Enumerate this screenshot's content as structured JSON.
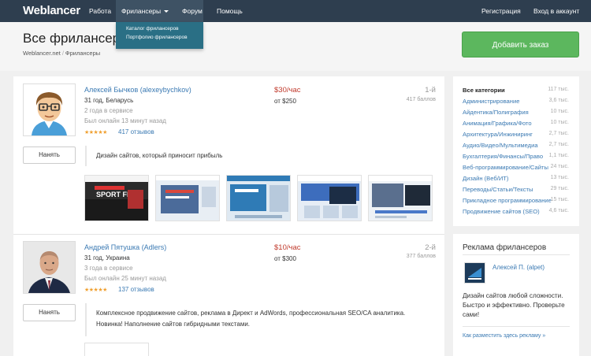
{
  "nav": {
    "logo": "Weblancer",
    "items": [
      {
        "label": "Работа"
      },
      {
        "label": "Фрилансеры"
      },
      {
        "label": "Форум"
      },
      {
        "label": "Помощь"
      }
    ],
    "register": "Регистрация",
    "login": "Вход в аккаунт",
    "dropdown": [
      "Каталог фрилансеров",
      "Портфолио фрилансеров"
    ]
  },
  "header": {
    "title": "Все фрилансеры",
    "breadcrumb": [
      "Weblancer.net",
      "Фрилансеры"
    ],
    "add_button": "Добавить заказ"
  },
  "freelancers": [
    {
      "name": "Алексей Бычков (alexeybychkov)",
      "age_country": "31 год, Беларусь",
      "in_service": "2 года в сервисе",
      "last_online": "Был онлайн 13 минут назад",
      "stars": "★★★★★",
      "reviews": "417 отзывов",
      "price": "$30/час",
      "price_from": "от $250",
      "rank": "1-й",
      "points": "417 баллов",
      "hire": "Нанять",
      "description": "Дизайн сайтов, который приносит прибыль"
    },
    {
      "name": "Андрей Пятушка (Adlers)",
      "age_country": "31 год, Украина",
      "in_service": "3 года в сервисе",
      "last_online": "Был онлайн 25 минут назад",
      "stars": "★★★★★",
      "reviews": "137 отзывов",
      "price": "$10/час",
      "price_from": "от $300",
      "rank": "2-й",
      "points": "377 баллов",
      "hire": "Нанять",
      "description": "Комплексное продвижение сайтов, реклама в Директ и AdWords, профессиональная SEO/CA аналитика. Новинка! Наполнение сайтов гибридными текстами."
    }
  ],
  "thumb_texts": [
    "SPORT FIT"
  ],
  "categories": [
    {
      "label": "Все категории",
      "count": "117 тыс."
    },
    {
      "label": "Администрирование",
      "count": "3,6 тыс."
    },
    {
      "label": "Айдентика/Полиграфия",
      "count": "10 тыс."
    },
    {
      "label": "Анимация/Графика/Фото",
      "count": "10 тыс."
    },
    {
      "label": "Архитектура/Инжиниринг",
      "count": "2,7 тыс."
    },
    {
      "label": "Аудио/Видео/Мультимедиа",
      "count": "2,7 тыс."
    },
    {
      "label": "Бухгалтерия/Финансы/Право",
      "count": "1,1 тыс."
    },
    {
      "label": "Веб-программирование/Сайты",
      "count": "24 тыс."
    },
    {
      "label": "Дизайн (Веб/ИТ)",
      "count": "13 тыс."
    },
    {
      "label": "Переводы/Статьи/Тексты",
      "count": "29 тыс."
    },
    {
      "label": "Прикладное программирование",
      "count": "15 тыс."
    },
    {
      "label": "Продвижение сайтов (SEO)",
      "count": "4,6 тыс."
    }
  ],
  "ads": {
    "title": "Реклама фрилансеров",
    "user": "Алексей П. (alpet)",
    "text": "Дизайн сайтов любой сложности. Быстро и эффективно. Проверьте сами!",
    "link": "Как разместить здесь рекламу »"
  },
  "colors": {
    "nav_bg": "#2e3e4f",
    "accent_green": "#5cb75e",
    "link": "#3b7ab3",
    "price": "#c0392b"
  }
}
